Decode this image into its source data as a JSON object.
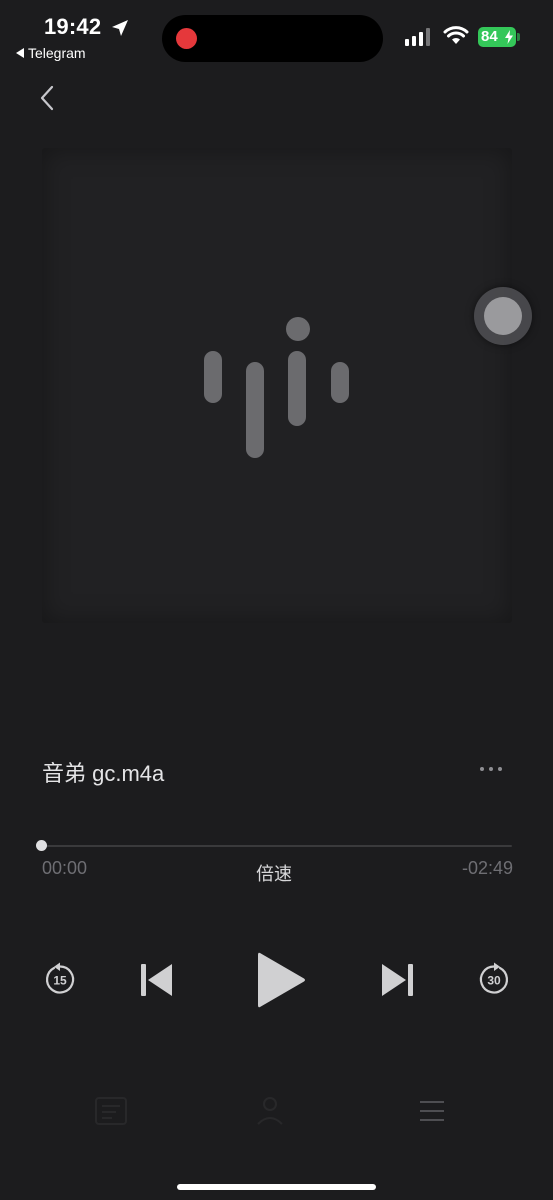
{
  "status_bar": {
    "time": "19:42",
    "back_app": "Telegram",
    "battery": "84",
    "battery_color": "#34c759",
    "recording_color": "#e5383b"
  },
  "nav": {
    "back_icon": "chevron-left-icon"
  },
  "track": {
    "title": "音弟 gc.m4a",
    "elapsed": "00:00",
    "remaining": "-02:49",
    "speed_label": "倍速",
    "progress": 0
  },
  "controls": {
    "rewind_seconds": "15",
    "forward_seconds": "30",
    "icons": [
      "rewind-15-icon",
      "previous-track-icon",
      "play-icon",
      "next-track-icon",
      "forward-30-icon"
    ]
  },
  "bottom_bar": {
    "icons": [
      "lyrics-icon",
      "voice-icon",
      "playlist-icon"
    ]
  },
  "colors": {
    "background": "#1c1c1e",
    "artwork": "#212123",
    "muted_text": "#6e6e73"
  }
}
